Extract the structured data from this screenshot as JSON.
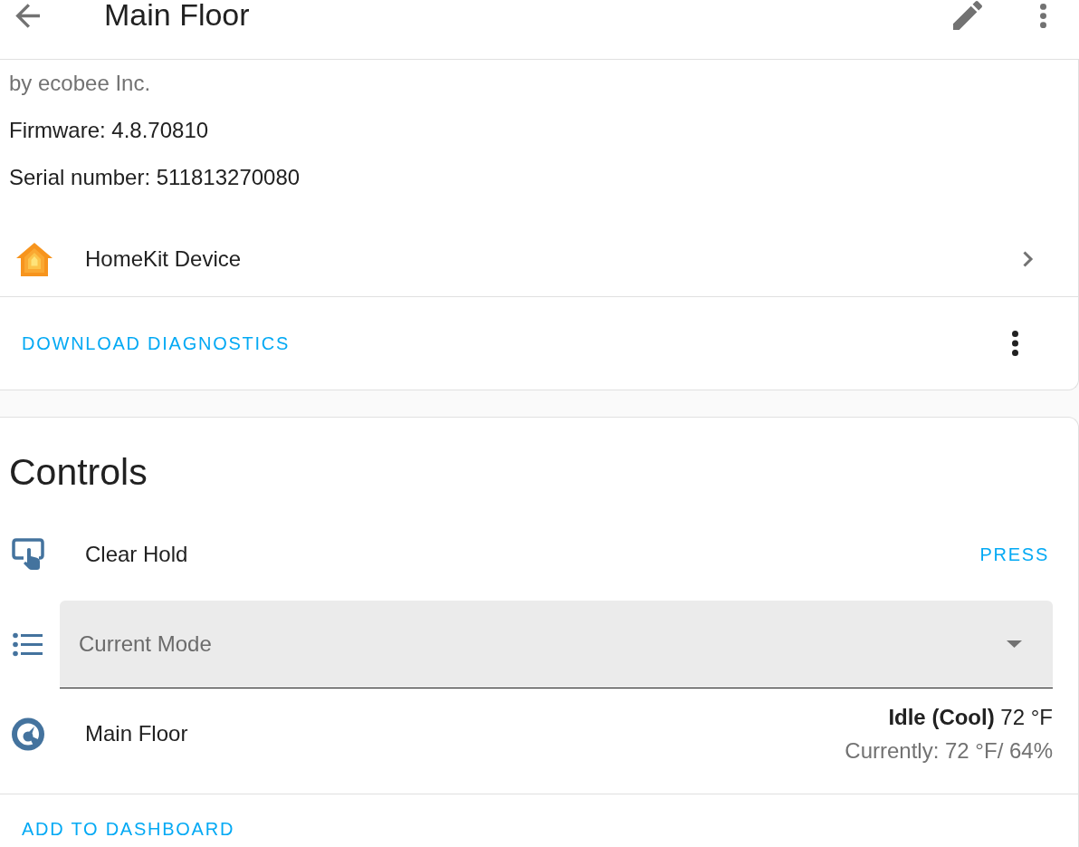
{
  "header": {
    "title": "Main Floor"
  },
  "device_info": {
    "manufacturer": "by ecobee Inc.",
    "details": [
      "Firmware: 4.8.70810",
      "Serial number: 511813270080"
    ],
    "integration": {
      "label": "HomeKit Device"
    },
    "diagnostics_button": "DOWNLOAD DIAGNOSTICS"
  },
  "controls": {
    "title": "Controls",
    "entities": [
      {
        "kind": "button",
        "name": "Clear Hold",
        "action": "PRESS"
      },
      {
        "kind": "select",
        "placeholder": "Current Mode"
      },
      {
        "kind": "climate",
        "name": "Main Floor",
        "state": "**Idle (Cool)** 72 °F",
        "current": "Currently: 72 °F/ 64%"
      }
    ],
    "add_button": "ADD TO DASHBOARD"
  }
}
